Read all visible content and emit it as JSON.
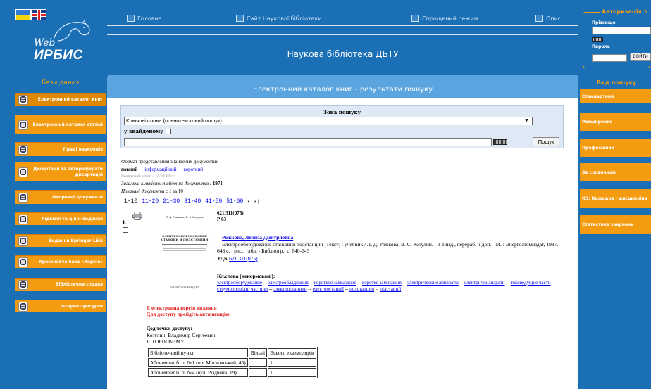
{
  "nav": {
    "home": "Головна",
    "library_site": "Сайт Наукової бібліотеки",
    "simple_mode": "Спрощений режим",
    "description": "Опис"
  },
  "logo": {
    "web": "Web",
    "irbis": "ИРБИС"
  },
  "site_title": "Наукова бібліотека ДБТУ",
  "databases": {
    "title": "Бази даних",
    "items": [
      {
        "label": "Електронний каталог книг"
      },
      {
        "label": "Електронний каталог статей"
      },
      {
        "label": "Праці науковців"
      },
      {
        "label": "Дисертації та автореферати дисертацій"
      },
      {
        "label": "Охоронні документи"
      },
      {
        "label": "Рідкісні та цінні видання"
      },
      {
        "label": "Видання Springer Link"
      },
      {
        "label": "Краєзнавча база «Харків»"
      },
      {
        "label": "Бібліотечна справа"
      },
      {
        "label": "Інтернет-ресурси"
      }
    ]
  },
  "main": {
    "header": "Електронний каталог книг - результати пошуку",
    "search_zone": {
      "title": "Зона пошуку",
      "selected": "Ключові слова (повнотекстовий пошук)",
      "in_found_label": "у знайденому",
      "query_value": "",
      "button": "Пошук"
    },
    "format": {
      "caption": "Формат представлення знайдених документів:",
      "full": "повний",
      "informational": "інформаційний",
      "short": "короткий"
    },
    "query_text": "Пошуковий запит: <.>V=EXT<.>",
    "total_label": "Загальна кількість знайдених документів",
    "total_value": "1971",
    "shown_label": "Показані документи",
    "shown_value": "с 1 за 10",
    "pager": [
      "1-10",
      "11-20",
      "21-30",
      "31-40",
      "41-50",
      "51-60"
    ],
    "pager_next": "▸",
    "pager_last": "▸|"
  },
  "record": {
    "number": "1.",
    "shelfmark_1": "621.311(075)",
    "shelfmark_2": "Р 63",
    "cover": {
      "authors": "Л. Д. Рожкова, В. С. Козулин",
      "title": "ЭЛЕКТРООБОРУДОВАНИЕ СТАНЦИЙ И ПОДСТАНЦИЙ",
      "publisher": "ЭНЕРГОАТОМИЗДАТ"
    },
    "author": "Рожкова, Лениза Дмитриевна",
    "description": "Электрооборудование станций и подстанций [Текст] : учебник / Л. Д. Рожкова, В. С. Козулин. - 3-е изд., перераб. и доп. - М. : Энергоатомиздат, 1987. - 648 с. : рис., табл. - Библиогр.: с. 640-643",
    "udc_label": "УДК",
    "udc_value": "621.311(075)",
    "keywords_title": "Кл.слова (ненормовані):",
    "keywords": [
      "электрооборудование",
      "электрообладнання",
      "короткое замыкание",
      "коротке замикання",
      "электрические аппараты",
      "електричні апарати",
      "токоведущие части",
      "струмопровідні частини",
      "электростанции",
      "електростанції",
      "подстанции",
      "підстанції"
    ],
    "keyword_separator": " -- ",
    "ev_line1": "Є електронна версія видання",
    "ev_line2": "Для доступу пройдіть авторизацію",
    "access_title": "Дод.точки доступу:",
    "access_person": "Козулин, Владимир Сергеевич",
    "access_history": "ІСТОРІЯ ВНМУ",
    "holdings": {
      "headers": [
        "Бібліотечний пункт",
        "Вільні",
        "Всього екземплярів"
      ],
      "rows": [
        [
          "Абонемент б. п. №1 (пр. Московський, 45)",
          "1",
          "1"
        ],
        [
          "Абонемент б. п. №4 (вул. Різдвяна, 19)",
          "1",
          "1"
        ]
      ]
    }
  },
  "auth": {
    "title": "Авторизація",
    "surname_label": "Прізвище",
    "surname_value": "",
    "password_label": "Пароль",
    "login_button": "ВОЙТИ"
  },
  "search_view": {
    "title": "Вид пошуку",
    "items": [
      {
        "label": "Стандартний"
      },
      {
        "label": "Розширений"
      },
      {
        "label": "Професійний"
      },
      {
        "label": "За словником"
      },
      {
        "label": "КЗ: Кафедра - дисципліна"
      },
      {
        "label": "Статистика звернень"
      }
    ]
  },
  "colors": {
    "background": "#1a6fb5",
    "accent_orange": "#f39c12",
    "panel_header": "#5aa5e0",
    "link": "#0000ee",
    "alert_red": "#e02020"
  }
}
